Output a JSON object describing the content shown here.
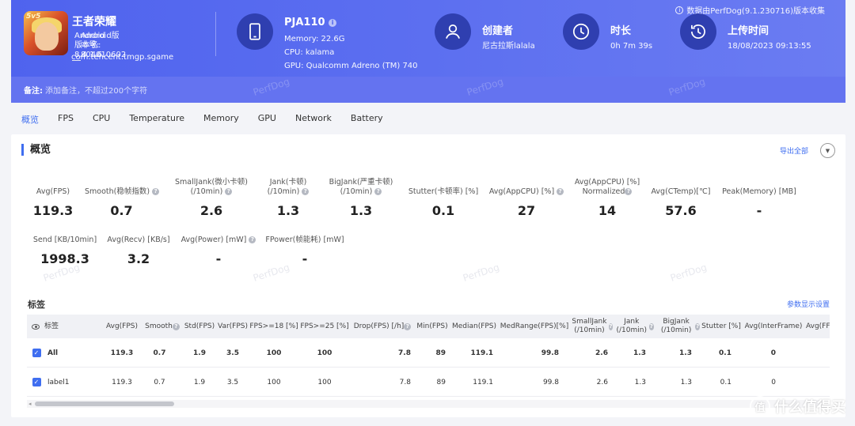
{
  "header": {
    "top_note": "数据由PerfDog(9.1.230716)版本收集",
    "app": {
      "name": "王者荣耀",
      "icon_badge": "5v5",
      "version_name": "Android版本名: 8.4.1.6",
      "version_code": "Android版本号: 804010602",
      "package": "com.tencent.tmgp.sgame"
    },
    "device": {
      "name": "PJA110",
      "memory": "Memory: 22.6G",
      "cpu": "CPU: kalama",
      "gpu": "GPU: Qualcomm Adreno (TM) 740"
    },
    "creator": {
      "title": "创建者",
      "value": "尼古拉斯lalala"
    },
    "duration": {
      "title": "时长",
      "value": "0h 7m 39s"
    },
    "upload": {
      "title": "上传时间",
      "value": "18/08/2023 09:13:55"
    },
    "remark": {
      "label": "备注:",
      "placeholder": "添加备注，不超过200个字符"
    },
    "watermark": "PerfDog"
  },
  "tabs": [
    "概览",
    "FPS",
    "CPU",
    "Temperature",
    "Memory",
    "GPU",
    "Network",
    "Battery"
  ],
  "overview": {
    "title": "概览",
    "export_label": "导出全部",
    "metrics": [
      {
        "label1": "Avg(FPS)",
        "label2": "",
        "value": "119.3"
      },
      {
        "label1": "Smooth(稳帧指数)",
        "label2": "",
        "value": "0.7"
      },
      {
        "label1": "SmallJank(微小卡顿)",
        "label2": "(/10min)",
        "value": "2.6"
      },
      {
        "label1": "Jank(卡顿)",
        "label2": "(/10min)",
        "value": "1.3"
      },
      {
        "label1": "BigJank(严重卡顿)",
        "label2": "(/10min)",
        "value": "1.3"
      },
      {
        "label1": "Stutter(卡顿率) [%]",
        "label2": "",
        "value": "0.1"
      },
      {
        "label1": "Avg(AppCPU) [%]",
        "label2": "",
        "value": "27"
      },
      {
        "label1": "Avg(AppCPU) [%]",
        "label2": "Normalized",
        "value": "14"
      },
      {
        "label1": "Avg(CTemp)[℃]",
        "label2": "",
        "value": "57.6"
      },
      {
        "label1": "Peak(Memory) [MB]",
        "label2": "",
        "value": "-"
      },
      {
        "label1": "Send [KB/10min]",
        "label2": "",
        "value": "1998.3"
      },
      {
        "label1": "Avg(Recv) [KB/s]",
        "label2": "",
        "value": "3.2"
      },
      {
        "label1": "Avg(Power) [mW]",
        "label2": "",
        "value": "-"
      },
      {
        "label1": "FPower(帧能耗) [mW]",
        "label2": "",
        "value": "-"
      }
    ]
  },
  "tags": {
    "title": "标签",
    "param_link": "参数显示设置",
    "columns": [
      "标签",
      "Avg(FPS)",
      "Smooth",
      "Std(FPS)",
      "Var(FPS)",
      "FPS>=18 [%]",
      "FPS>=25 [%]",
      "Drop(FPS) [/h]",
      "Min(FPS)",
      "Median(FPS)",
      "MedRange(FPS)[%]",
      "SmallJank (/10min)",
      "Jank (/10min)",
      "BigJank (/10min)",
      "Stutter [%]",
      "Avg(InterFrame)",
      "Avg(FF"
    ],
    "rows": [
      {
        "label": "All",
        "values": [
          "119.3",
          "0.7",
          "1.9",
          "3.5",
          "100",
          "100",
          "7.8",
          "89",
          "119.1",
          "99.8",
          "2.6",
          "1.3",
          "1.3",
          "0.1",
          "0"
        ]
      },
      {
        "label": "label1",
        "values": [
          "119.3",
          "0.7",
          "1.9",
          "3.5",
          "100",
          "100",
          "7.8",
          "89",
          "119.1",
          "99.8",
          "2.6",
          "1.3",
          "1.3",
          "0.1",
          "0"
        ]
      }
    ]
  },
  "corner_logo": {
    "glyph": "值",
    "text": "什么值得买"
  }
}
